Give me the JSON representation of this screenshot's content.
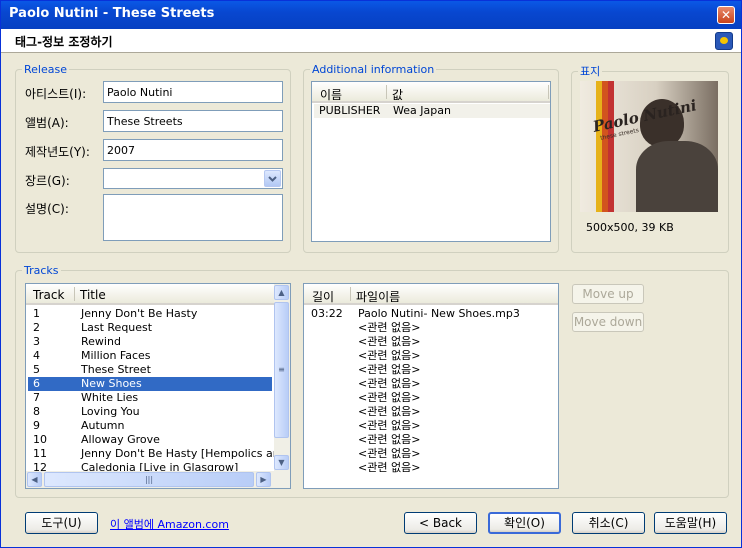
{
  "window": {
    "title": "Paolo Nutini - These Streets",
    "close_glyph": "✕"
  },
  "header": {
    "title": "태그-정보 조정하기"
  },
  "release": {
    "legend": "Release",
    "artist_label": "아티스트(I):",
    "artist_value": "Paolo Nutini",
    "album_label": "앨범(A):",
    "album_value": "These Streets",
    "year_label": "제작년도(Y):",
    "year_value": "2007",
    "genre_label": "장르(G):",
    "genre_value": "",
    "desc_label": "설명(C):",
    "desc_value": ""
  },
  "additional": {
    "legend": "Additional information",
    "col_name": "이름",
    "col_value": "값",
    "rows": [
      {
        "name": "PUBLISHER",
        "value": "Wea Japan"
      }
    ]
  },
  "cover": {
    "legend": "표지",
    "info": "500x500, 39 KB",
    "art_text": "Paolo Nutini",
    "art_subtext": "these streets"
  },
  "tracks": {
    "legend": "Tracks",
    "col_track": "Track",
    "col_title": "Title",
    "items": [
      {
        "n": "1",
        "t": "Jenny Don't Be Hasty"
      },
      {
        "n": "2",
        "t": "Last Request"
      },
      {
        "n": "3",
        "t": "Rewind"
      },
      {
        "n": "4",
        "t": "Million Faces"
      },
      {
        "n": "5",
        "t": "These Street"
      },
      {
        "n": "6",
        "t": "New Shoes"
      },
      {
        "n": "7",
        "t": "White Lies"
      },
      {
        "n": "8",
        "t": "Loving You"
      },
      {
        "n": "9",
        "t": "Autumn"
      },
      {
        "n": "10",
        "t": "Alloway Grove"
      },
      {
        "n": "11",
        "t": "Jenny Don't Be Hasty [Hempolics and P..."
      },
      {
        "n": "12",
        "t": "Caledonia [Live in Glasgrow]"
      }
    ],
    "selected": "6"
  },
  "files": {
    "col_length": "길이",
    "col_filename": "파일이름",
    "items": [
      {
        "len": "03:22",
        "name": "Paolo Nutini- New Shoes.mp3"
      },
      {
        "len": "",
        "name": "<관련 없음>"
      },
      {
        "len": "",
        "name": "<관련 없음>"
      },
      {
        "len": "",
        "name": "<관련 없음>"
      },
      {
        "len": "",
        "name": "<관련 없음>"
      },
      {
        "len": "",
        "name": "<관련 없음>"
      },
      {
        "len": "",
        "name": "<관련 없음>"
      },
      {
        "len": "",
        "name": "<관련 없음>"
      },
      {
        "len": "",
        "name": "<관련 없음>"
      },
      {
        "len": "",
        "name": "<관련 없음>"
      },
      {
        "len": "",
        "name": "<관련 없음>"
      },
      {
        "len": "",
        "name": "<관련 없음>"
      }
    ]
  },
  "buttons": {
    "move_up": "Move up",
    "move_down": "Move down",
    "tools": "도구(U)",
    "amazon": "이 앨범에 Amazon.com",
    "back": "< Back",
    "ok": "확인(O)",
    "cancel": "취소(C)",
    "help": "도움말(H)"
  },
  "colors": {
    "selection": "#316ac5",
    "legend": "#0046d5",
    "titlebar": "#0a58e6"
  }
}
